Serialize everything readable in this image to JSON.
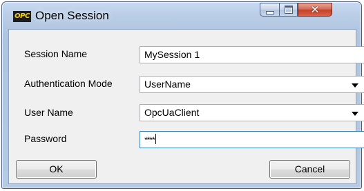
{
  "window": {
    "title": "Open Session",
    "app_icon_text": "OPC",
    "controls": {
      "minimize": "minimize-icon",
      "maximize": "maximize-icon",
      "close": "close-icon"
    }
  },
  "form": {
    "session_name": {
      "label": "Session Name",
      "value": "MySession 1"
    },
    "auth_mode": {
      "label": "Authentication Mode",
      "value": "UserName"
    },
    "user_name": {
      "label": "User Name",
      "value": "OpcUaClient"
    },
    "password": {
      "label": "Password",
      "value": "****"
    }
  },
  "buttons": {
    "ok": "OK",
    "cancel": "Cancel"
  }
}
